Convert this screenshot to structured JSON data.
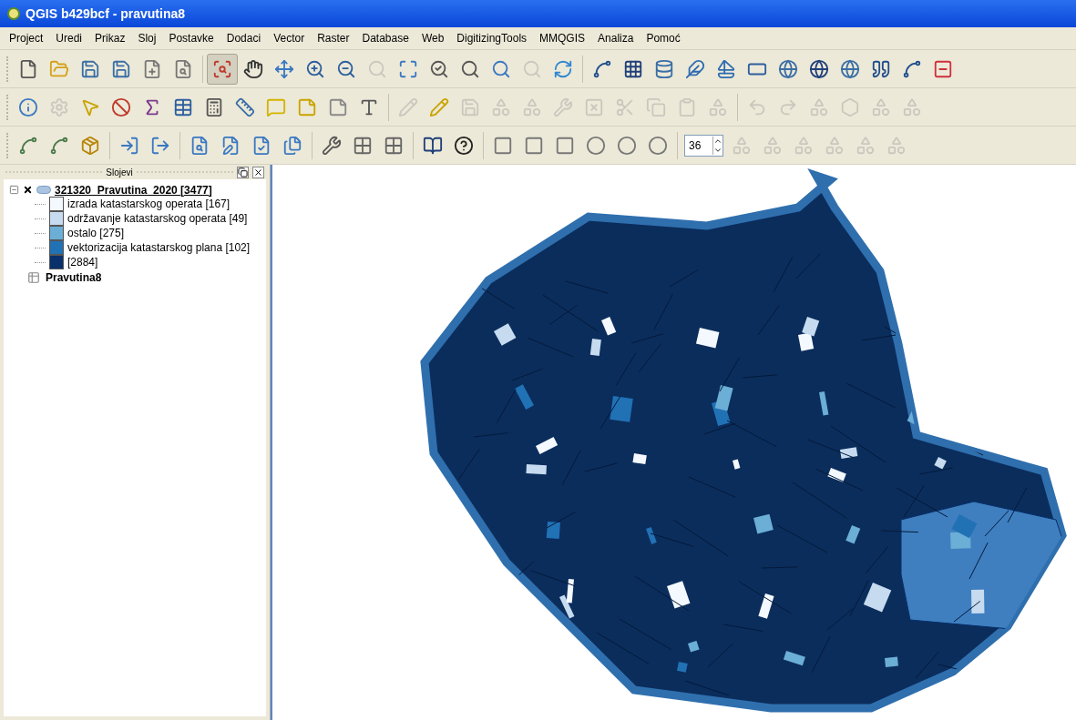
{
  "window": {
    "title": "QGIS b429bcf - pravutina8"
  },
  "menu": [
    "Project",
    "Uredi",
    "Prikaz",
    "Sloj",
    "Postavke",
    "Dodaci",
    "Vector",
    "Raster",
    "Database",
    "Web",
    "DigitizingTools",
    "MMQGIS",
    "Analiza",
    "Pomoć"
  ],
  "toolbars": [
    {
      "buttons": [
        {
          "kind": "icon",
          "disabled": false,
          "pressed": false
        },
        {
          "kind": "icon",
          "disabled": false,
          "pressed": false
        },
        {
          "kind": "icon",
          "disabled": false,
          "pressed": false
        },
        {
          "kind": "icon",
          "disabled": false,
          "pressed": false
        },
        {
          "kind": "icon",
          "disabled": false,
          "pressed": false
        },
        {
          "kind": "icon",
          "disabled": false,
          "pressed": false
        },
        {
          "kind": "icon",
          "disabled": false,
          "pressed": true
        },
        {
          "kind": "icon",
          "disabled": false,
          "pressed": false
        },
        {
          "kind": "icon",
          "disabled": false,
          "pressed": false
        },
        {
          "kind": "icon",
          "disabled": false,
          "pressed": false
        },
        {
          "kind": "icon",
          "disabled": false,
          "pressed": false
        },
        {
          "kind": "icon",
          "disabled": true,
          "pressed": false
        },
        {
          "kind": "icon",
          "disabled": false,
          "pressed": false
        },
        {
          "kind": "icon",
          "disabled": false,
          "pressed": false
        },
        {
          "kind": "icon",
          "disabled": false,
          "pressed": false
        },
        {
          "kind": "icon",
          "disabled": false,
          "pressed": false
        },
        {
          "kind": "icon",
          "disabled": true,
          "pressed": false
        },
        {
          "kind": "icon",
          "disabled": false,
          "pressed": false
        },
        {
          "kind": "icon",
          "disabled": false,
          "pressed": false
        },
        {
          "kind": "icon",
          "disabled": false,
          "pressed": false
        },
        {
          "kind": "icon",
          "disabled": false,
          "pressed": false
        },
        {
          "kind": "icon",
          "disabled": false,
          "pressed": false
        },
        {
          "kind": "icon",
          "disabled": false,
          "pressed": false
        },
        {
          "kind": "icon",
          "disabled": false,
          "pressed": false
        },
        {
          "kind": "icon",
          "disabled": false,
          "pressed": false
        },
        {
          "kind": "icon",
          "disabled": false,
          "pressed": false
        },
        {
          "kind": "icon",
          "disabled": false,
          "pressed": false
        },
        {
          "kind": "icon",
          "disabled": false,
          "pressed": false
        },
        {
          "kind": "icon",
          "disabled": false,
          "pressed": false
        },
        {
          "kind": "icon",
          "disabled": false,
          "pressed": false
        }
      ]
    },
    {
      "buttons": [
        {
          "kind": "icon",
          "disabled": false,
          "pressed": false
        },
        {
          "kind": "icon",
          "disabled": true,
          "pressed": false
        },
        {
          "kind": "icon",
          "disabled": false,
          "pressed": false
        },
        {
          "kind": "icon",
          "disabled": false,
          "pressed": false
        },
        {
          "kind": "icon",
          "disabled": false,
          "pressed": false
        },
        {
          "kind": "icon",
          "disabled": false,
          "pressed": false
        },
        {
          "kind": "icon",
          "disabled": false,
          "pressed": false
        },
        {
          "kind": "icon",
          "disabled": false,
          "pressed": false
        },
        {
          "kind": "icon",
          "disabled": false,
          "pressed": false
        },
        {
          "kind": "icon",
          "disabled": false,
          "pressed": false
        },
        {
          "kind": "icon",
          "disabled": false,
          "pressed": false
        },
        {
          "kind": "icon",
          "disabled": false,
          "pressed": false
        },
        {
          "kind": "icon",
          "disabled": true,
          "pressed": false
        },
        {
          "kind": "icon",
          "disabled": false,
          "pressed": false
        },
        {
          "kind": "icon",
          "disabled": true,
          "pressed": false
        },
        {
          "kind": "icon",
          "disabled": true,
          "pressed": false
        },
        {
          "kind": "icon",
          "disabled": true,
          "pressed": false
        },
        {
          "kind": "icon",
          "disabled": true,
          "pressed": false
        },
        {
          "kind": "icon",
          "disabled": true,
          "pressed": false
        },
        {
          "kind": "icon",
          "disabled": true,
          "pressed": false
        },
        {
          "kind": "icon",
          "disabled": true,
          "pressed": false
        },
        {
          "kind": "icon",
          "disabled": true,
          "pressed": false
        },
        {
          "kind": "icon",
          "disabled": true,
          "pressed": false
        },
        {
          "kind": "icon",
          "disabled": true,
          "pressed": false
        },
        {
          "kind": "icon",
          "disabled": true,
          "pressed": false
        },
        {
          "kind": "icon",
          "disabled": true,
          "pressed": false
        },
        {
          "kind": "icon",
          "disabled": true,
          "pressed": false
        },
        {
          "kind": "icon",
          "disabled": true,
          "pressed": false
        },
        {
          "kind": "icon",
          "disabled": true,
          "pressed": false
        }
      ]
    },
    {
      "buttons": [
        {
          "kind": "icon",
          "disabled": false,
          "pressed": false
        },
        {
          "kind": "icon",
          "disabled": false,
          "pressed": false
        },
        {
          "kind": "icon",
          "disabled": false,
          "pressed": false
        },
        {
          "kind": "icon",
          "disabled": false,
          "pressed": false
        },
        {
          "kind": "icon",
          "disabled": false,
          "pressed": false
        },
        {
          "kind": "icon",
          "disabled": false,
          "pressed": false
        },
        {
          "kind": "icon",
          "disabled": false,
          "pressed": false
        },
        {
          "kind": "icon",
          "disabled": false,
          "pressed": false
        },
        {
          "kind": "icon",
          "disabled": false,
          "pressed": false
        },
        {
          "kind": "icon",
          "disabled": false,
          "pressed": false
        },
        {
          "kind": "icon",
          "disabled": false,
          "pressed": false
        },
        {
          "kind": "icon",
          "disabled": false,
          "pressed": false
        },
        {
          "kind": "icon",
          "disabled": false,
          "pressed": false
        },
        {
          "kind": "icon",
          "disabled": false,
          "pressed": false
        },
        {
          "kind": "icon",
          "disabled": false,
          "pressed": false
        },
        {
          "kind": "icon",
          "disabled": false,
          "pressed": false
        },
        {
          "kind": "icon",
          "disabled": false,
          "pressed": false
        },
        {
          "kind": "icon",
          "disabled": false,
          "pressed": false
        },
        {
          "kind": "icon",
          "disabled": false,
          "pressed": false
        },
        {
          "kind": "icon",
          "disabled": false,
          "pressed": false
        },
        {
          "kind": "spin",
          "value": "36"
        },
        {
          "kind": "icon",
          "disabled": true,
          "pressed": false
        },
        {
          "kind": "icon",
          "disabled": true,
          "pressed": false
        },
        {
          "kind": "icon",
          "disabled": true,
          "pressed": false
        },
        {
          "kind": "icon",
          "disabled": true,
          "pressed": false
        },
        {
          "kind": "icon",
          "disabled": true,
          "pressed": false
        },
        {
          "kind": "icon",
          "disabled": true,
          "pressed": false
        }
      ]
    }
  ],
  "layers_panel": {
    "title": "Slojevi",
    "layers": [
      {
        "kind": "vector",
        "name": "321320_Pravutina_2020 [3477]",
        "expanded": true,
        "checked": true,
        "legend": [
          {
            "label": "izrada katastarskog operata [167]",
            "color": "#f4f9ff"
          },
          {
            "label": "održavanje katastarskog operata [49]",
            "color": "#c6dbef"
          },
          {
            "label": "ostalo [275]",
            "color": "#6baed6"
          },
          {
            "label": "vektorizacija katastarskog plana [102]",
            "color": "#2171b5"
          },
          {
            "label": "[2884]",
            "color": "#08306b"
          }
        ]
      },
      {
        "kind": "table",
        "name": "Pravutina8"
      }
    ]
  }
}
